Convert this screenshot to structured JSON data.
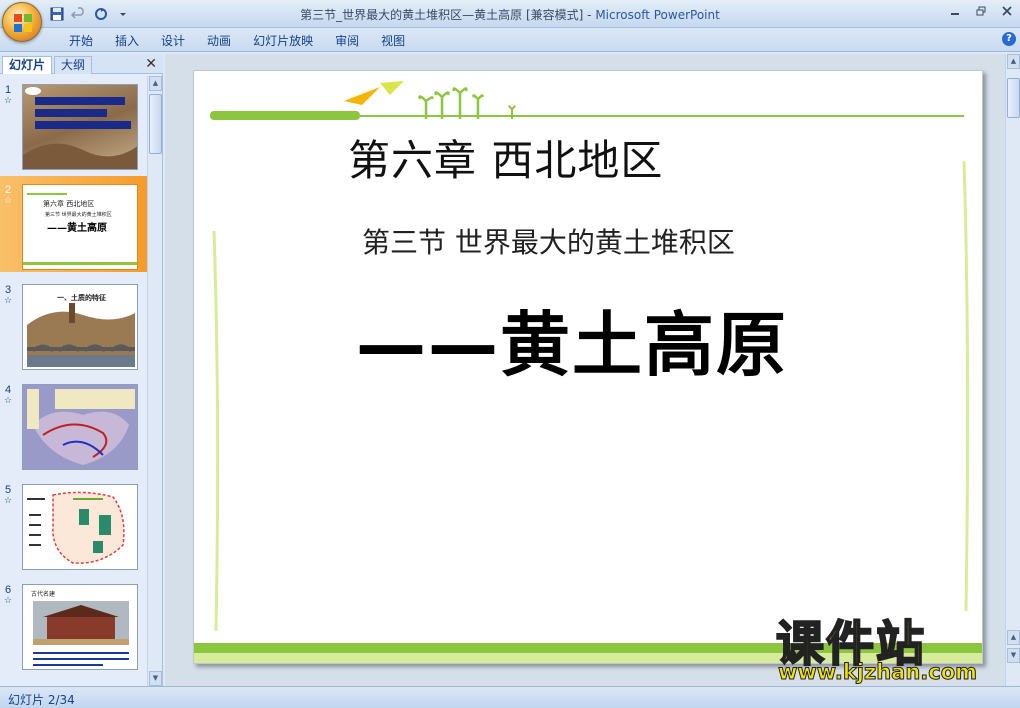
{
  "window": {
    "title_prefix": "第三节_世界最大的黄土堆积区—黄土高原 [兼容模式] - ",
    "title_app": "Microsoft PowerPoint"
  },
  "ribbon": {
    "tabs": [
      "开始",
      "插入",
      "设计",
      "动画",
      "幻灯片放映",
      "审阅",
      "视图"
    ],
    "help_label": "?"
  },
  "panel": {
    "tab_slides": "幻灯片",
    "tab_outline": "大纲",
    "close_label": "✕",
    "thumbnails": [
      {
        "num": "1",
        "star": "☆"
      },
      {
        "num": "2",
        "star": "☆"
      },
      {
        "num": "3",
        "star": "☆"
      },
      {
        "num": "4",
        "star": "☆"
      },
      {
        "num": "5",
        "star": "☆"
      },
      {
        "num": "6",
        "star": "☆"
      }
    ],
    "thumb_texts": {
      "t2_line1": "第六章  西北地区",
      "t2_line2": "第三节 世界最大的黄土堆积区",
      "t2_line3": "——黄土高原",
      "t3_title": "一、土质的特征",
      "t6_title": "古代名建"
    }
  },
  "slide": {
    "chapter_title": "第六章  西北地区",
    "section_title": "第三节 世界最大的黄土堆积区",
    "main_title": "——黄土高原"
  },
  "status": {
    "slide_counter": "幻灯片 2/34"
  },
  "watermark": {
    "title": "课件站",
    "url": "www.kjzhan.com"
  },
  "colors": {
    "accent_green": "#8cc63f",
    "selection_orange": "#f59b2b",
    "ribbon_blue": "#c9dbf1"
  }
}
